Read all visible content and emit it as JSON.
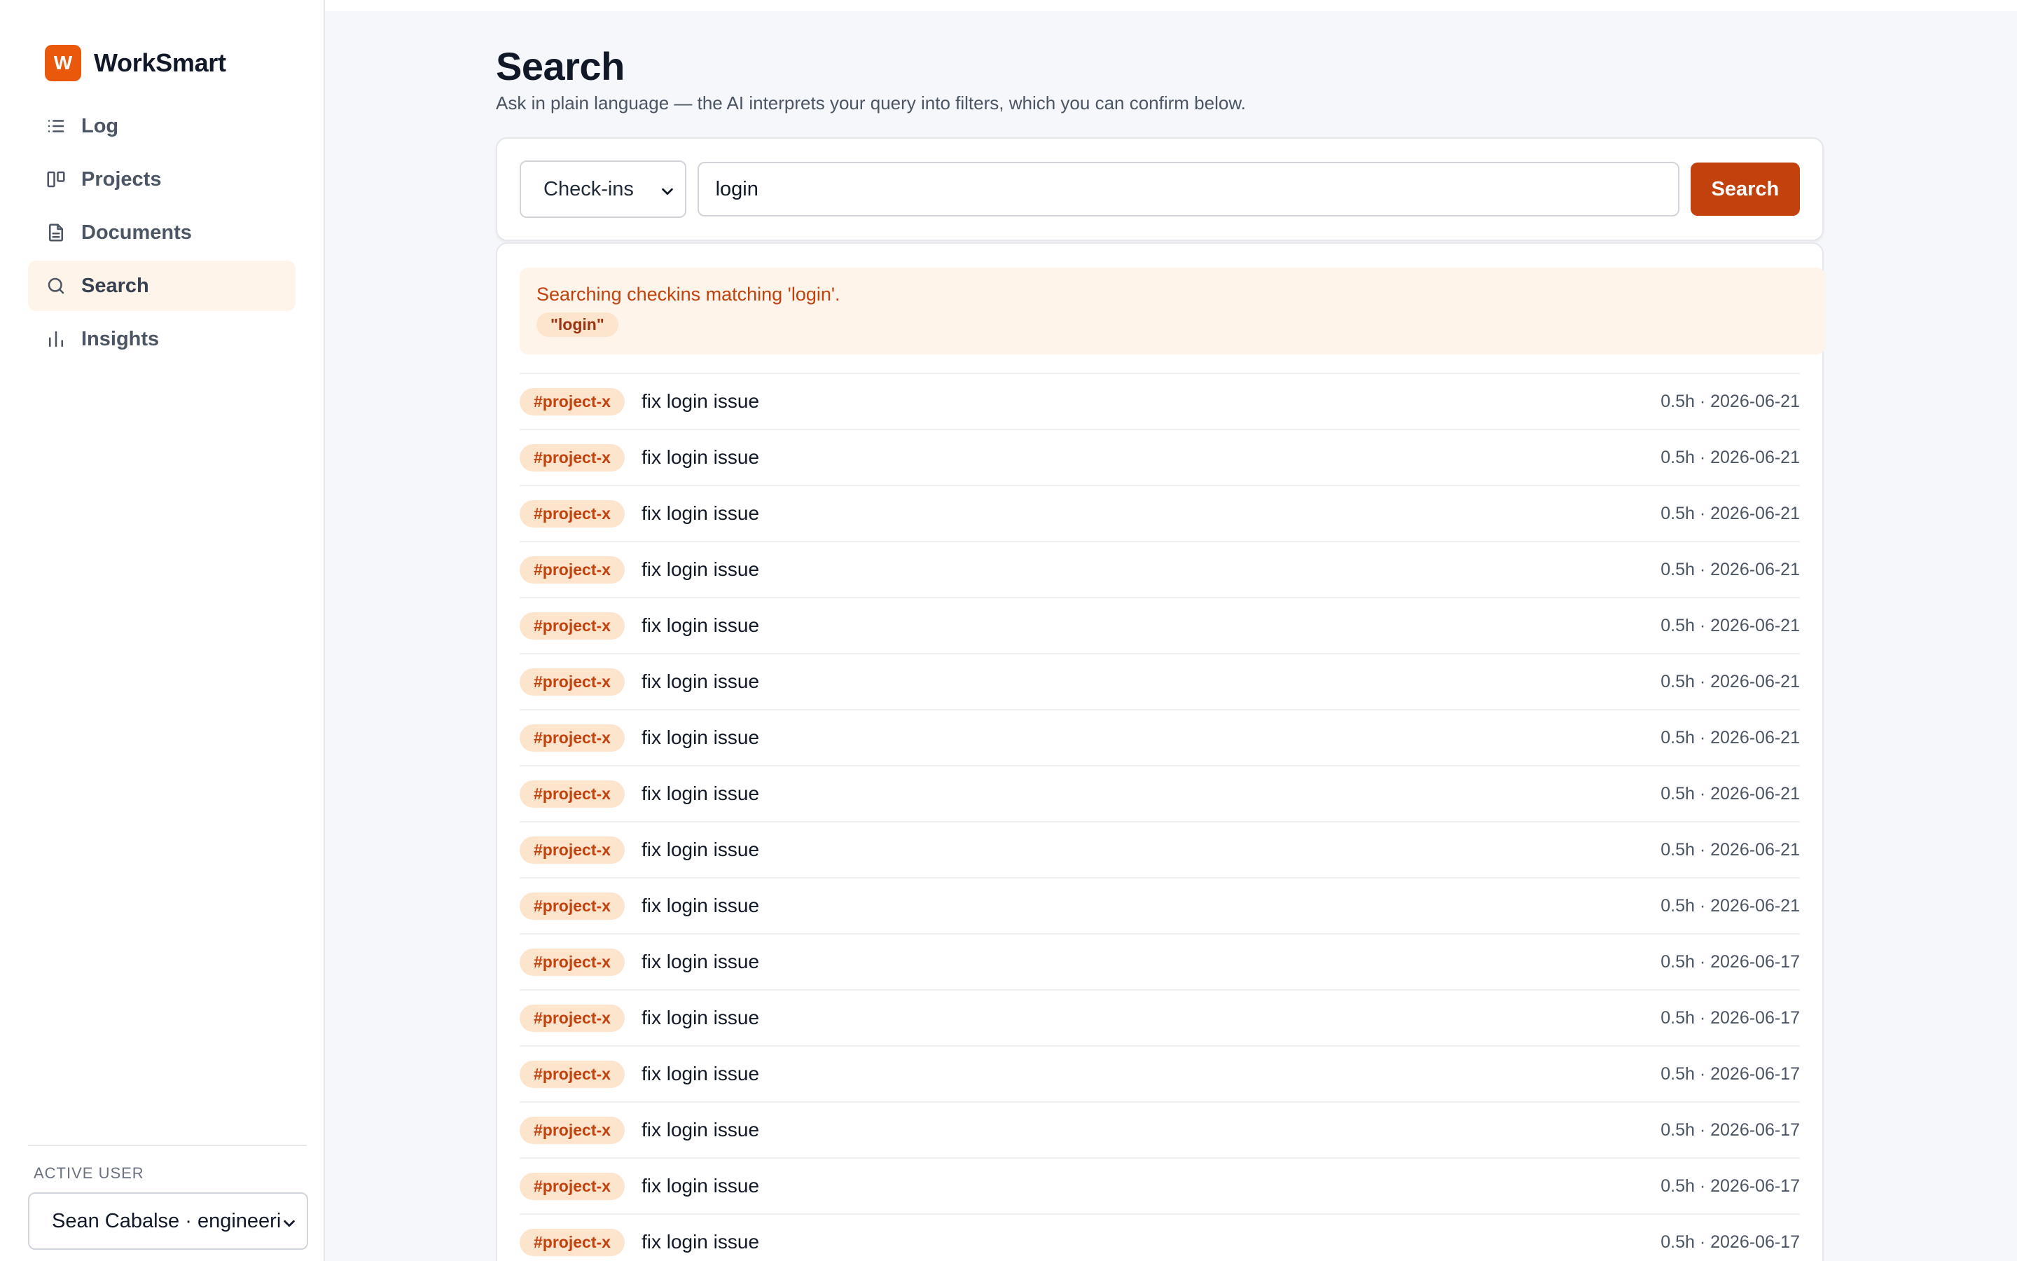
{
  "app": {
    "logo_letter": "W",
    "name": "WorkSmart"
  },
  "sidebar": {
    "items": [
      {
        "label": "Log",
        "icon": "list-icon",
        "active": false
      },
      {
        "label": "Projects",
        "icon": "board-icon",
        "active": false
      },
      {
        "label": "Documents",
        "icon": "document-icon",
        "active": false
      },
      {
        "label": "Search",
        "icon": "search-icon",
        "active": true
      },
      {
        "label": "Insights",
        "icon": "bar-chart-icon",
        "active": false
      }
    ],
    "active_user_label": "ACTIVE USER",
    "active_user_value": "Sean Cabalse · engineering"
  },
  "page": {
    "title": "Search",
    "subtitle": "Ask in plain language — the AI interprets your query into filters, which you can confirm below."
  },
  "search": {
    "type_value": "Check-ins",
    "query_value": "login",
    "button_label": "Search"
  },
  "interpretation": {
    "text": "Searching checkins matching 'login'.",
    "chips": [
      "\"login\""
    ]
  },
  "results": [
    {
      "tag": "#project-x",
      "text": "fix login issue",
      "meta": "0.5h · 2026-06-21"
    },
    {
      "tag": "#project-x",
      "text": "fix login issue",
      "meta": "0.5h · 2026-06-21"
    },
    {
      "tag": "#project-x",
      "text": "fix login issue",
      "meta": "0.5h · 2026-06-21"
    },
    {
      "tag": "#project-x",
      "text": "fix login issue",
      "meta": "0.5h · 2026-06-21"
    },
    {
      "tag": "#project-x",
      "text": "fix login issue",
      "meta": "0.5h · 2026-06-21"
    },
    {
      "tag": "#project-x",
      "text": "fix login issue",
      "meta": "0.5h · 2026-06-21"
    },
    {
      "tag": "#project-x",
      "text": "fix login issue",
      "meta": "0.5h · 2026-06-21"
    },
    {
      "tag": "#project-x",
      "text": "fix login issue",
      "meta": "0.5h · 2026-06-21"
    },
    {
      "tag": "#project-x",
      "text": "fix login issue",
      "meta": "0.5h · 2026-06-21"
    },
    {
      "tag": "#project-x",
      "text": "fix login issue",
      "meta": "0.5h · 2026-06-21"
    },
    {
      "tag": "#project-x",
      "text": "fix login issue",
      "meta": "0.5h · 2026-06-17"
    },
    {
      "tag": "#project-x",
      "text": "fix login issue",
      "meta": "0.5h · 2026-06-17"
    },
    {
      "tag": "#project-x",
      "text": "fix login issue",
      "meta": "0.5h · 2026-06-17"
    },
    {
      "tag": "#project-x",
      "text": "fix login issue",
      "meta": "0.5h · 2026-06-17"
    },
    {
      "tag": "#project-x",
      "text": "fix login issue",
      "meta": "0.5h · 2026-06-17"
    },
    {
      "tag": "#project-x",
      "text": "fix login issue",
      "meta": "0.5h · 2026-06-17"
    }
  ],
  "colors": {
    "accent": "#ea580c",
    "button": "#c2410c",
    "tag_bg": "#fde4cc",
    "active_nav_bg": "#fff4e9"
  }
}
